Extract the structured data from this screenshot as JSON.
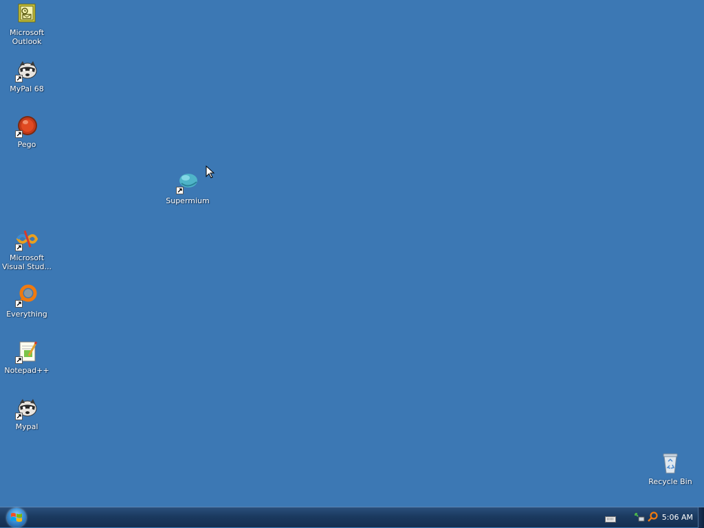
{
  "desktop": {
    "background_color": "#3c78b4",
    "icons": [
      {
        "label": "Microsoft\nOutlook",
        "icon": "outlook-icon",
        "shortcut": false
      },
      {
        "label": "MyPal 68",
        "icon": "raccoon-icon",
        "shortcut": true
      },
      {
        "label": "Pego",
        "icon": "pego-icon",
        "shortcut": true
      },
      {
        "label": "Supermium",
        "icon": "supermium-icon",
        "shortcut": true
      },
      {
        "label": "Microsoft\nVisual Stud...",
        "icon": "visual-studio-icon",
        "shortcut": true
      },
      {
        "label": "Everything",
        "icon": "everything-icon",
        "shortcut": true
      },
      {
        "label": "Notepad++",
        "icon": "notepadpp-icon",
        "shortcut": true
      },
      {
        "label": "Mypal",
        "icon": "raccoon-icon",
        "shortcut": true
      },
      {
        "label": "Recycle Bin",
        "icon": "recycle-bin-icon",
        "shortcut": false
      }
    ]
  },
  "taskbar": {
    "start_button": "start-orb-icon",
    "tray_icons": [
      "keyboard-icon",
      "network-icon",
      "search-icon"
    ],
    "clock": "5:06 AM"
  }
}
